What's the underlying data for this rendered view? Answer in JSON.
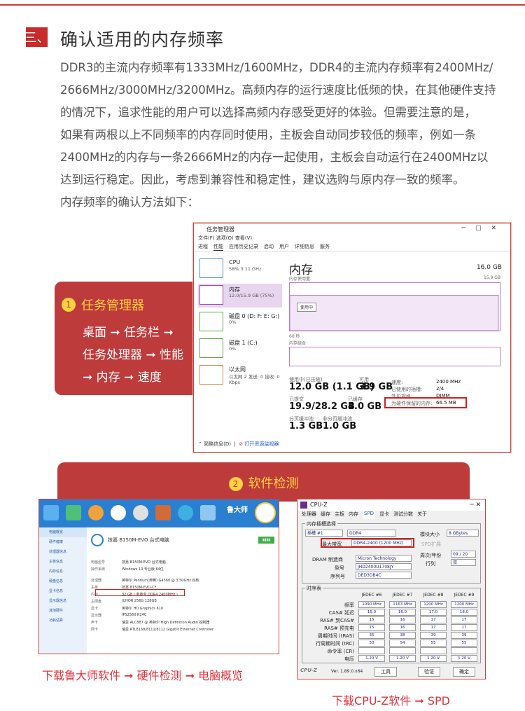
{
  "section": {
    "badge": "三、",
    "title": "确认适用的内存频率"
  },
  "paragraph": [
    "DDR3的主流内存频率有1333MHz/1600MHz，DDR4的主流内存频率有2400MHz/",
    "2666MHz/3000MHz/3200MHz。高频内存的运行速度比低频的快，在其他硬件支持",
    "的情况下，追求性能的用户可以选择高频内存感受更好的体验。但需要注意的是，",
    "如果有两根以上不同频率的内存同时使用，主板会自动同步较低的频率，例如一条",
    "2400MHz的内存与一条2666MHz的内存一起使用，主板会自动运行在2400MHz以",
    "达到运行稳定。因此，考虑到兼容性和稳定性，建议选购与原内存一致的频率。",
    "内存频率的确认方法如下："
  ],
  "method1": {
    "number": "1",
    "title": "任务管理器",
    "lines": [
      "桌面 ➞ 任务栏 ➞",
      "任务处理器 ➞ 性能",
      "➞ 内存 ➞ 速度"
    ]
  },
  "method2": {
    "number": "2",
    "title": "软件检测"
  },
  "task_manager": {
    "window_title": "任务管理器",
    "menu": "文件(F)  选项(O)  查看(V)",
    "tabs": [
      "进程",
      "性能",
      "应用历史记录",
      "启动",
      "用户",
      "详细信息",
      "服务"
    ],
    "left_items": [
      {
        "name": "CPU",
        "detail": "58% 3.11 GHz"
      },
      {
        "name": "内存",
        "detail": "12.0/15.9 GB (75%)"
      },
      {
        "name": "磁盘 0 (D: F: E: G:)",
        "detail": "0%"
      },
      {
        "name": "磁盘 1 (C:)",
        "detail": "0%"
      },
      {
        "name": "以太网",
        "detail": "以太网 2  发送: 0 接收: 0 Kbps"
      }
    ],
    "memory_title": "内存",
    "memory_total": "16.0 GB",
    "graph_top": "15.9 GB",
    "graph_label": "内存使用量",
    "graph_tooltip": "使用中",
    "time_label": "60 秒",
    "composition_label": "内存组合",
    "in_use_label": "使用中(已压缩)",
    "in_use_value": "12.0 GB (1.1 GB)",
    "available_label": "可用",
    "available_value": "3.9 GB",
    "committed_label": "已提交",
    "committed_value": "19.9/28.2 GB",
    "cached_label": "已缓存",
    "cached_value": "4.0 GB",
    "paged_label": "分页缓冲池",
    "paged_value": "1.3 GB",
    "nonpaged_label": "非分页缓冲池",
    "nonpaged_value": "1.0 GB",
    "speed_label": "速度:",
    "speed_value": "2400 MHz",
    "slots_label": "已使用的插槽:",
    "slots_value": "2/4",
    "form_label": "外形规格:",
    "form_value": "DIMM",
    "reserved_label": "为硬件保留的内存:",
    "reserved_value": "66.5 MB",
    "footer_brief": "简略信息(D)",
    "footer_monitor": "打开资源监视器"
  },
  "ludashi": {
    "brand": "鲁大师",
    "computer_name": "技嘉 B150M-EVO 台式电脑",
    "menu_items": [
      "电脑概览",
      "硬件健康",
      "处理器信息",
      "主板信息",
      "内存信息",
      "硬盘信息",
      "显卡信息",
      "显示器信息",
      "其他硬件",
      "功耗估算"
    ],
    "rows": [
      {
        "label": "电脑型号",
        "value": "技嘉 B150M-EVO 台式电脑"
      },
      {
        "label": "操作系统",
        "value": "Windows 10 专业版 64位"
      },
      {
        "label": "处理器",
        "value": "英特尔 Pentium(奔腾) G4560 @ 3.50GHz 双核"
      },
      {
        "label": "主板",
        "value": "技嘉 B150M-EVO-CF"
      },
      {
        "label": "内存",
        "value": "32 GB ( 金泰克 DDR4 2400MHz )"
      },
      {
        "label": "主硬盘",
        "value": "JUHOR 256G 128GB"
      },
      {
        "label": "显卡",
        "value": "英特尔 HD Graphics 610"
      },
      {
        "label": "显示器",
        "value": "IPS2560 R24C"
      },
      {
        "label": "声卡",
        "value": "瑞昱 ALC887 @ 英特尔 High Definition Audio 控制器"
      },
      {
        "label": "网卡",
        "value": "瑞昱 RTL8168/8111/8112 Gigabit Ethernet Controller"
      }
    ],
    "caption": "下载鲁大师软件 ➞ 硬件检测 ➞ 电脑概览"
  },
  "cpuz": {
    "title": "CPU-Z",
    "tabs": [
      "处理器",
      "缓存",
      "主板",
      "内存",
      "SPD",
      "显卡",
      "测试分数",
      "关于"
    ],
    "active_tab": "SPD",
    "group": "内存插槽选择",
    "slot": "插槽 #1",
    "type": "DDR4",
    "module_size_label": "模块大小",
    "module_size": "8 GBytes",
    "max_bw_label": "最大带宽",
    "max_bw": "DDR4-2400 (1200 MHz)",
    "spd_ext_label": "SPD扩展",
    "manufacturer_label": "DRAM 制造商",
    "manufacturer": "Micron Technology",
    "week_year_label": "周次/年份",
    "week_year": "09 / 20",
    "part_label": "型号",
    "part": "JHD2400U1708JY",
    "rank_label": "行列",
    "rank": "双",
    "serial_label": "序列号",
    "serial": "DED3DB4C",
    "timing_group": "时序表",
    "timing_cols": [
      "JEDEC #6",
      "JEDEC #7",
      "JEDEC #8",
      "JEDEC #9"
    ],
    "timing_rows": [
      {
        "label": "频率",
        "values": [
          "1090 MHz",
          "1163 MHz",
          "1200 MHz",
          "1200 MHz"
        ]
      },
      {
        "label": "CAS# 延迟",
        "values": [
          "15.0",
          "16.0",
          "17.0",
          "18.0"
        ]
      },
      {
        "label": "RAS# 到CAS#",
        "values": [
          "15",
          "16",
          "17",
          "17"
        ]
      },
      {
        "label": "RAS# 预充电",
        "values": [
          "15",
          "16",
          "17",
          "17"
        ]
      },
      {
        "label": "周期时间 (tRAS)",
        "values": [
          "35",
          "38",
          "39",
          "39"
        ]
      },
      {
        "label": "行周期时间 (tRC)",
        "values": [
          "50",
          "54",
          "55",
          "55"
        ]
      },
      {
        "label": "命令率 (CR)",
        "values": [
          "",
          "",
          "",
          ""
        ]
      },
      {
        "label": "电压",
        "values": [
          "1.20 V",
          "1.20 V",
          "1.20 V",
          "1.20 V"
        ]
      }
    ],
    "version": "Ver. 1.89.0.x64",
    "tools": "工具",
    "validate": "验证",
    "ok": "确定",
    "caption": "下载CPU-Z软件 ➞ SPD"
  }
}
